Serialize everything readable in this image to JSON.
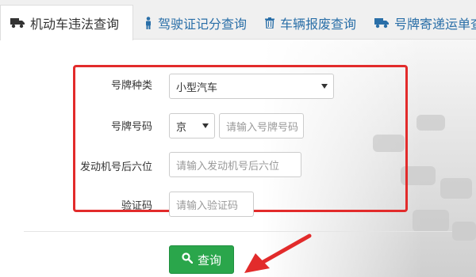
{
  "tabs": [
    {
      "label": "机动车违法查询",
      "icon": "truck-icon",
      "active": true
    },
    {
      "label": "驾驶证记分查询",
      "icon": "person-icon",
      "active": false
    },
    {
      "label": "车辆报废查询",
      "icon": "trash-icon",
      "active": false
    },
    {
      "label": "号牌寄递运单查",
      "icon": "truck-icon",
      "active": false
    }
  ],
  "form": {
    "plate_type": {
      "label": "号牌种类",
      "value": "小型汽车"
    },
    "plate_number": {
      "label": "号牌号码",
      "prefix": "京",
      "placeholder": "请输入号牌号码"
    },
    "engine": {
      "label": "发动机号后六位",
      "placeholder": "请输入发动机号后六位"
    },
    "captcha": {
      "label": "验证码",
      "placeholder": "请输入验证码"
    }
  },
  "query_button": {
    "label": "查询",
    "icon": "search-icon",
    "color": "#2aa64b"
  },
  "colors": {
    "highlight": "#e22b2b",
    "tab_link": "#2a6fa8",
    "arrow": "#e22b2b"
  }
}
